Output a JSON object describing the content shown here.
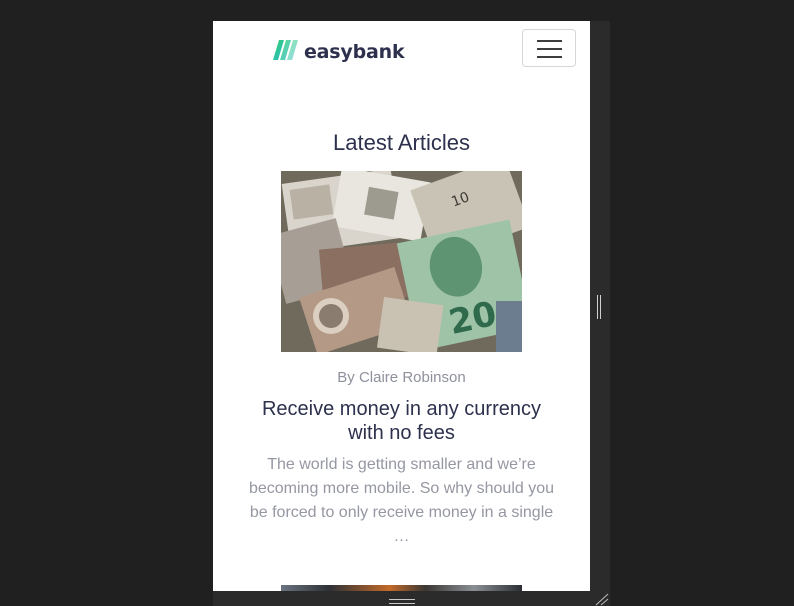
{
  "header": {
    "logo_text": "easybank",
    "menu_icon": "hamburger-icon"
  },
  "main": {
    "section_title": "Latest Articles",
    "articles": [
      {
        "image": "money-banknotes-photo",
        "author": "By Claire Robinson",
        "title": "Receive money in any currency with no fees",
        "excerpt": "The world is getting smaller and we’re becoming more mobile. So why should you be forced to only receive money in a single …"
      }
    ]
  },
  "colors": {
    "background": "#202020",
    "page": "#ffffff",
    "heading": "#2d314d",
    "muted": "#9597a2",
    "logo_green": "#31d35c",
    "logo_cyan": "#2bb7da"
  }
}
